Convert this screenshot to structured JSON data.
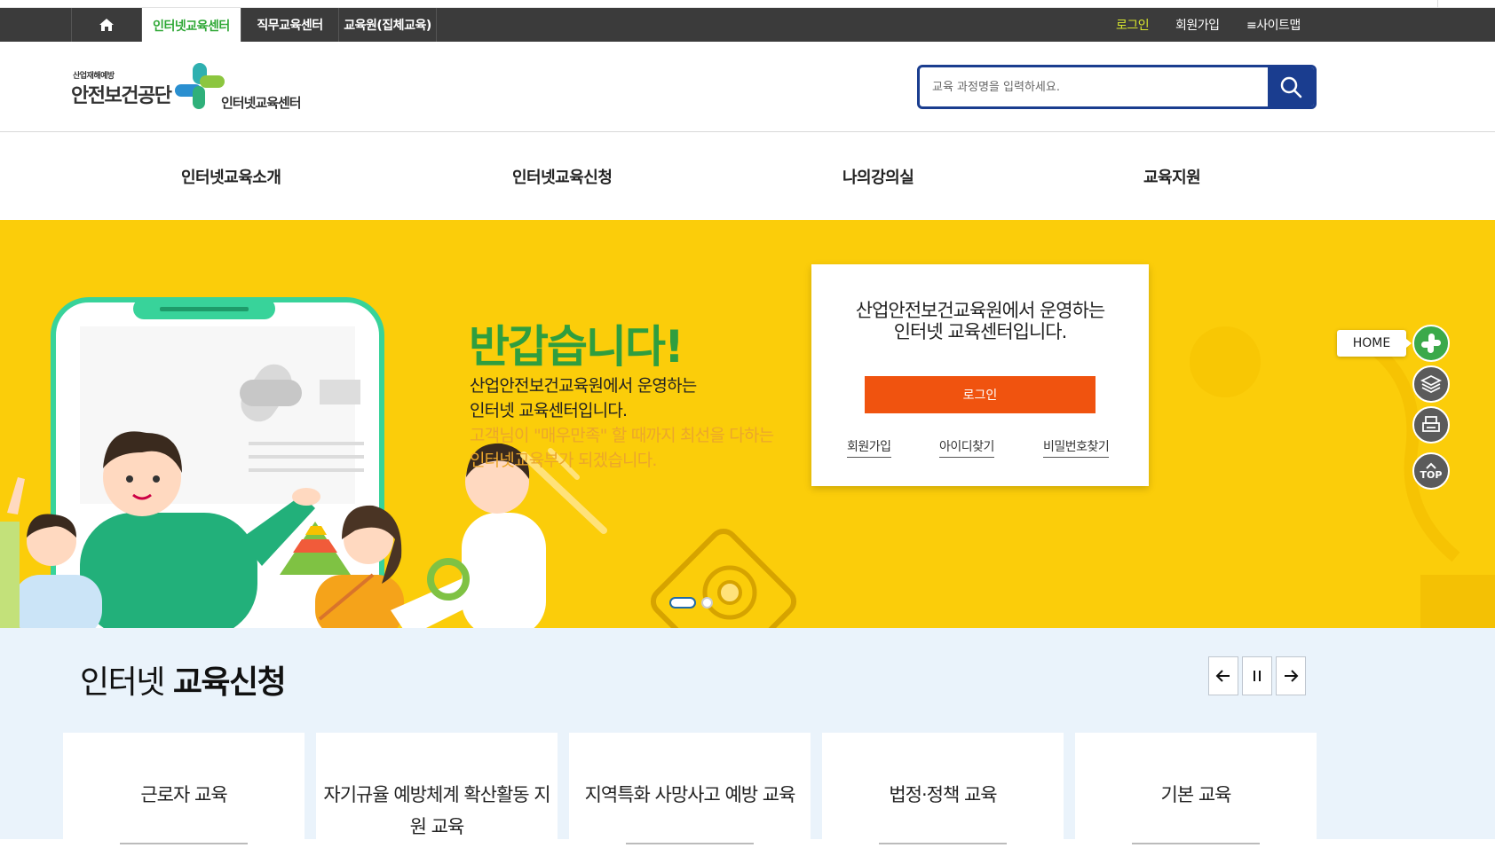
{
  "topbar": {
    "home_label": "home",
    "tabs": [
      "인터넷교육센터",
      "직무교육센터",
      "교육원(집체교육)"
    ],
    "utils": [
      "로그인",
      "회원가입",
      "≡사이트맵"
    ]
  },
  "header": {
    "logo_small": "산업재해예방",
    "logo_big": "안전보건공단",
    "logo_sub": "인터넷교육센터",
    "search_placeholder": "교육 과정명을 입력하세요."
  },
  "gnb": [
    "인터넷교육소개",
    "인터넷교육신청",
    "나의강의실",
    "교육지원"
  ],
  "hero": {
    "welcome": "반갑습니다!",
    "desc": [
      "산업안전보건교육원에서 운영하는",
      "인터넷 교육센터입니다.",
      "고객님이 \"매우만족\" 할 때까지 최선을 다하는",
      "인터넷교육부가 되겠습니다."
    ]
  },
  "login_card": {
    "line1": "산업안전보건교육원에서 운영하는",
    "line2": "인터넷 교육센터입니다.",
    "login_button": "로그인",
    "links": [
      "회원가입",
      "아이디찾기",
      "비밀번호찾기"
    ]
  },
  "quick_menu": {
    "home_label": "HOME",
    "top_label": "TOP"
  },
  "section": {
    "title_light": "인터넷 ",
    "title_bold": "교육신청",
    "cards": [
      {
        "name": "근로자 교육"
      },
      {
        "name": "자기규율 예방체계 확산활동 지원 교육"
      },
      {
        "name": "지역특화 사망사고 예방 교육"
      },
      {
        "name": "법정·정책 교육"
      },
      {
        "name": "기본 교육"
      }
    ]
  },
  "colors": {
    "hero_bg": "#fbcd0a",
    "brand_green": "#2f9e3f",
    "search_navy": "#1a3d8f",
    "login_orange": "#f0530f"
  }
}
